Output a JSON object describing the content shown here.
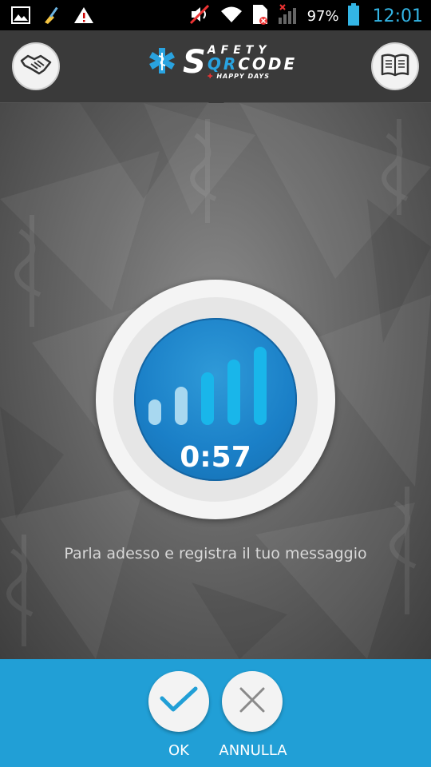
{
  "status_bar": {
    "battery_percent": "97%",
    "clock": "12:01",
    "icons": [
      "gallery-icon",
      "cleaner-icon",
      "warning-icon",
      "mute-icon",
      "wifi-icon",
      "sim-icon",
      "signal-icon",
      "battery-icon"
    ]
  },
  "header": {
    "left_button_icon": "handshake-icon",
    "right_button_icon": "book-icon",
    "logo": {
      "line1": "AFETY",
      "line2_qr": "QR",
      "line2_rest": "CODE",
      "sub": "HAPPY DAYS"
    }
  },
  "recorder": {
    "timer": "0:57",
    "level_bars": 5,
    "accent": "#1a7fc7"
  },
  "hint": "Parla adesso e registra il tuo messaggio",
  "actions": {
    "ok_label": "OK",
    "cancel_label": "ANNULLA",
    "bar_color": "#219fd6"
  }
}
